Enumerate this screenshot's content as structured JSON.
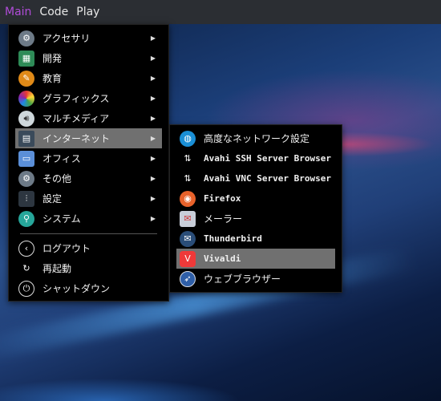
{
  "panel": {
    "items": [
      {
        "label": "Main",
        "active": true
      },
      {
        "label": "Code",
        "active": false
      },
      {
        "label": "Play",
        "active": false
      }
    ]
  },
  "main_menu": {
    "categories": [
      {
        "label": "アクセサリ",
        "icon": "gear-icon"
      },
      {
        "label": "開発",
        "icon": "development-icon"
      },
      {
        "label": "教育",
        "icon": "education-icon"
      },
      {
        "label": "グラフィックス",
        "icon": "graphics-icon"
      },
      {
        "label": "マルチメディア",
        "icon": "speaker-icon"
      },
      {
        "label": "インターネット",
        "icon": "network-icon",
        "selected": true
      },
      {
        "label": "オフィス",
        "icon": "document-icon"
      },
      {
        "label": "その他",
        "icon": "gear-icon"
      },
      {
        "label": "設定",
        "icon": "sliders-icon"
      },
      {
        "label": "システム",
        "icon": "system-search-icon"
      }
    ],
    "actions": [
      {
        "label": "ログアウト",
        "icon": "logout-icon"
      },
      {
        "label": "再起動",
        "icon": "restart-icon"
      },
      {
        "label": "シャットダウン",
        "icon": "power-icon"
      }
    ],
    "arrow": "▶"
  },
  "internet_submenu": {
    "items": [
      {
        "label": "高度なネットワーク設定",
        "icon": "globe-icon"
      },
      {
        "label": "Avahi SSH Server Browser",
        "icon": "up-down-arrows-icon"
      },
      {
        "label": "Avahi VNC Server Browser",
        "icon": "up-down-arrows-icon"
      },
      {
        "label": "Firefox",
        "icon": "firefox-icon"
      },
      {
        "label": "メーラー",
        "icon": "mail-icon"
      },
      {
        "label": "Thunderbird",
        "icon": "thunderbird-icon"
      },
      {
        "label": "Vivaldi",
        "icon": "vivaldi-icon",
        "selected": true
      },
      {
        "label": "ウェブブラウザー",
        "icon": "compass-icon"
      }
    ]
  },
  "colors": {
    "panel_bg": "#2b2e33",
    "active_panel_text": "#b04cd8",
    "menu_bg": "#000000",
    "selection": "#707070"
  }
}
